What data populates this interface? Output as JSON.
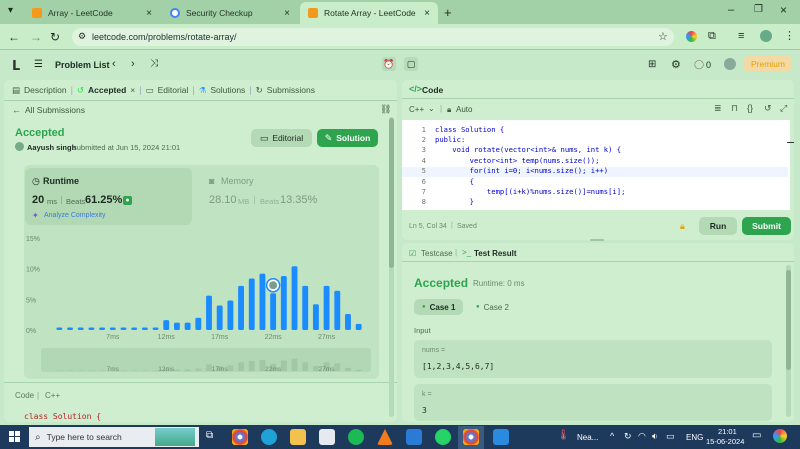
{
  "browser": {
    "tabs": [
      {
        "title": "Array - LeetCode",
        "active": false
      },
      {
        "title": "Security Checkup",
        "active": false
      },
      {
        "title": "Rotate Array - LeetCode",
        "active": true
      }
    ],
    "url": "leetcode.com/problems/rotate-array/"
  },
  "header": {
    "problem_list": "Problem List",
    "fire_count": "0",
    "premium": "Premium"
  },
  "left": {
    "tabs": [
      "Description",
      "Accepted",
      "Editorial",
      "Solutions",
      "Submissions"
    ],
    "all_submissions": "All Submissions",
    "status": "Accepted",
    "user": "Aayush singh",
    "submitted": "submitted at Jun 15, 2024 21:01",
    "editorial_btn": "Editorial",
    "solution_btn": "Solution",
    "runtime_label": "Runtime",
    "runtime_value": "20",
    "runtime_unit": "ms",
    "beats_label": "Beats",
    "runtime_beats": "61.25%",
    "analyze": "Analyze Complexity",
    "memory_label": "Memory",
    "memory_value": "28.10",
    "memory_unit": "MB",
    "memory_beats": "13.35%",
    "code_label": "Code",
    "code_lang": "C++",
    "code_preview": "class Solution {"
  },
  "chart_data": {
    "type": "bar",
    "ylabels": [
      "15%",
      "10%",
      "5%",
      "0%"
    ],
    "ylim": [
      0,
      15
    ],
    "xticks": [
      "7ms",
      "12ms",
      "17ms",
      "22ms",
      "27ms"
    ],
    "values": [
      0.4,
      0.4,
      0.4,
      0.4,
      0.4,
      0.4,
      0.4,
      0.4,
      0.4,
      0.4,
      1.6,
      1.2,
      1.2,
      2.0,
      5.6,
      4.0,
      4.8,
      7.2,
      8.4,
      9.2,
      6.0,
      8.8,
      10.4,
      7.2,
      4.2,
      7.2,
      6.4,
      2.6,
      1.0
    ],
    "highlight_index": 20
  },
  "editor": {
    "title": "Code",
    "lang": "C++",
    "auto": "Auto",
    "lines": [
      {
        "n": "1",
        "t": "class Solution {"
      },
      {
        "n": "2",
        "t": "public:"
      },
      {
        "n": "3",
        "t": "    void rotate(vector<int>& nums, int k) {"
      },
      {
        "n": "4",
        "t": "        vector<int> temp(nums.size());"
      },
      {
        "n": "5",
        "t": "        for(int i=0; i<nums.size(); i++)"
      },
      {
        "n": "6",
        "t": "        {"
      },
      {
        "n": "7",
        "t": "            temp[(i+k)%nums.size()]=nums[i];"
      },
      {
        "n": "8",
        "t": "        }"
      }
    ],
    "status": "Ln 5, Col 34",
    "saved": "Saved",
    "run": "Run",
    "submit": "Submit"
  },
  "result": {
    "testcase_tab": "Testcase",
    "result_tab": "Test Result",
    "status": "Accepted",
    "runtime": "Runtime: 0 ms",
    "case1": "Case 1",
    "case2": "Case 2",
    "input_label": "Input",
    "nums_label": "nums =",
    "nums_value": "[1,2,3,4,5,6,7]",
    "k_label": "k =",
    "k_value": "3"
  },
  "taskbar": {
    "search": "Type here to search",
    "weather": "Nea...",
    "lang": "ENG",
    "time": "21:01",
    "date": "15-06-2024"
  },
  "colors": {
    "accent": "#2ea44f",
    "bar": "#1a8cff",
    "taskbar": "#1d3a5c"
  }
}
